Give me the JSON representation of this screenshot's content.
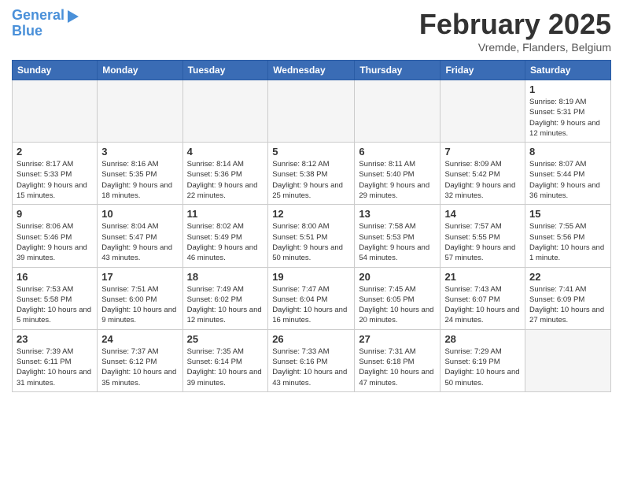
{
  "header": {
    "logo_line1": "General",
    "logo_line2": "Blue",
    "title": "February 2025",
    "subtitle": "Vremde, Flanders, Belgium"
  },
  "weekdays": [
    "Sunday",
    "Monday",
    "Tuesday",
    "Wednesday",
    "Thursday",
    "Friday",
    "Saturday"
  ],
  "weeks": [
    [
      {
        "day": "",
        "info": ""
      },
      {
        "day": "",
        "info": ""
      },
      {
        "day": "",
        "info": ""
      },
      {
        "day": "",
        "info": ""
      },
      {
        "day": "",
        "info": ""
      },
      {
        "day": "",
        "info": ""
      },
      {
        "day": "1",
        "info": "Sunrise: 8:19 AM\nSunset: 5:31 PM\nDaylight: 9 hours and 12 minutes."
      }
    ],
    [
      {
        "day": "2",
        "info": "Sunrise: 8:17 AM\nSunset: 5:33 PM\nDaylight: 9 hours and 15 minutes."
      },
      {
        "day": "3",
        "info": "Sunrise: 8:16 AM\nSunset: 5:35 PM\nDaylight: 9 hours and 18 minutes."
      },
      {
        "day": "4",
        "info": "Sunrise: 8:14 AM\nSunset: 5:36 PM\nDaylight: 9 hours and 22 minutes."
      },
      {
        "day": "5",
        "info": "Sunrise: 8:12 AM\nSunset: 5:38 PM\nDaylight: 9 hours and 25 minutes."
      },
      {
        "day": "6",
        "info": "Sunrise: 8:11 AM\nSunset: 5:40 PM\nDaylight: 9 hours and 29 minutes."
      },
      {
        "day": "7",
        "info": "Sunrise: 8:09 AM\nSunset: 5:42 PM\nDaylight: 9 hours and 32 minutes."
      },
      {
        "day": "8",
        "info": "Sunrise: 8:07 AM\nSunset: 5:44 PM\nDaylight: 9 hours and 36 minutes."
      }
    ],
    [
      {
        "day": "9",
        "info": "Sunrise: 8:06 AM\nSunset: 5:46 PM\nDaylight: 9 hours and 39 minutes."
      },
      {
        "day": "10",
        "info": "Sunrise: 8:04 AM\nSunset: 5:47 PM\nDaylight: 9 hours and 43 minutes."
      },
      {
        "day": "11",
        "info": "Sunrise: 8:02 AM\nSunset: 5:49 PM\nDaylight: 9 hours and 46 minutes."
      },
      {
        "day": "12",
        "info": "Sunrise: 8:00 AM\nSunset: 5:51 PM\nDaylight: 9 hours and 50 minutes."
      },
      {
        "day": "13",
        "info": "Sunrise: 7:58 AM\nSunset: 5:53 PM\nDaylight: 9 hours and 54 minutes."
      },
      {
        "day": "14",
        "info": "Sunrise: 7:57 AM\nSunset: 5:55 PM\nDaylight: 9 hours and 57 minutes."
      },
      {
        "day": "15",
        "info": "Sunrise: 7:55 AM\nSunset: 5:56 PM\nDaylight: 10 hours and 1 minute."
      }
    ],
    [
      {
        "day": "16",
        "info": "Sunrise: 7:53 AM\nSunset: 5:58 PM\nDaylight: 10 hours and 5 minutes."
      },
      {
        "day": "17",
        "info": "Sunrise: 7:51 AM\nSunset: 6:00 PM\nDaylight: 10 hours and 9 minutes."
      },
      {
        "day": "18",
        "info": "Sunrise: 7:49 AM\nSunset: 6:02 PM\nDaylight: 10 hours and 12 minutes."
      },
      {
        "day": "19",
        "info": "Sunrise: 7:47 AM\nSunset: 6:04 PM\nDaylight: 10 hours and 16 minutes."
      },
      {
        "day": "20",
        "info": "Sunrise: 7:45 AM\nSunset: 6:05 PM\nDaylight: 10 hours and 20 minutes."
      },
      {
        "day": "21",
        "info": "Sunrise: 7:43 AM\nSunset: 6:07 PM\nDaylight: 10 hours and 24 minutes."
      },
      {
        "day": "22",
        "info": "Sunrise: 7:41 AM\nSunset: 6:09 PM\nDaylight: 10 hours and 27 minutes."
      }
    ],
    [
      {
        "day": "23",
        "info": "Sunrise: 7:39 AM\nSunset: 6:11 PM\nDaylight: 10 hours and 31 minutes."
      },
      {
        "day": "24",
        "info": "Sunrise: 7:37 AM\nSunset: 6:12 PM\nDaylight: 10 hours and 35 minutes."
      },
      {
        "day": "25",
        "info": "Sunrise: 7:35 AM\nSunset: 6:14 PM\nDaylight: 10 hours and 39 minutes."
      },
      {
        "day": "26",
        "info": "Sunrise: 7:33 AM\nSunset: 6:16 PM\nDaylight: 10 hours and 43 minutes."
      },
      {
        "day": "27",
        "info": "Sunrise: 7:31 AM\nSunset: 6:18 PM\nDaylight: 10 hours and 47 minutes."
      },
      {
        "day": "28",
        "info": "Sunrise: 7:29 AM\nSunset: 6:19 PM\nDaylight: 10 hours and 50 minutes."
      },
      {
        "day": "",
        "info": ""
      }
    ]
  ]
}
